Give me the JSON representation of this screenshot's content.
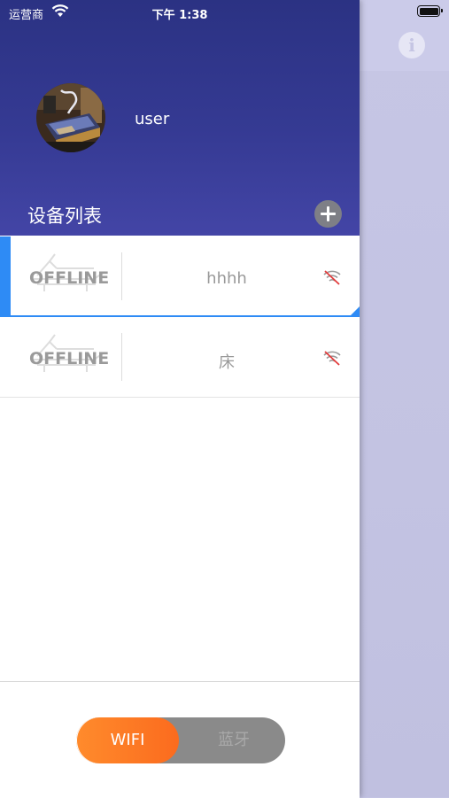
{
  "status_bar": {
    "carrier": "运营商",
    "time": "下午 1:38"
  },
  "profile": {
    "username": "user"
  },
  "devices_section": {
    "title": "设备列表"
  },
  "devices": [
    {
      "status": "OFFLINE",
      "name": "hhhh",
      "selected": true
    },
    {
      "status": "OFFLINE",
      "name": "床",
      "selected": false
    }
  ],
  "connection_toggle": {
    "wifi_label": "WIFI",
    "bluetooth_label": "蓝牙",
    "selected": "WIFI"
  },
  "colors": {
    "header_gradient_top": "#2b3283",
    "header_gradient_bottom": "#4345a6",
    "selection_accent": "#2e8bf5",
    "toggle_active": "#fb6b1e",
    "toggle_inactive": "#8a8a8a"
  },
  "icons": [
    "wifi-icon",
    "battery-icon",
    "info-icon",
    "add-icon",
    "bed-icon",
    "wifi-off-icon"
  ]
}
